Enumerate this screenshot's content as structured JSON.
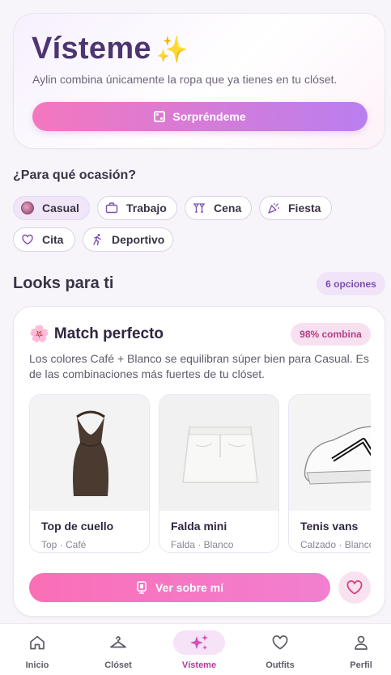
{
  "hero": {
    "title": "Vísteme",
    "sparkle": "✨",
    "subtitle": "Aylin combina únicamente la ropa que ya tienes en tu clóset.",
    "cta_label": "Sorpréndeme"
  },
  "occasion": {
    "question": "¿Para qué ocasión?",
    "chips": [
      {
        "label": "Casual",
        "icon": "casual-dot-icon",
        "selected": true
      },
      {
        "label": "Trabajo",
        "icon": "briefcase-icon",
        "selected": false
      },
      {
        "label": "Cena",
        "icon": "dinner-icon",
        "selected": false
      },
      {
        "label": "Fiesta",
        "icon": "party-popper-icon",
        "selected": false
      },
      {
        "label": "Cita",
        "icon": "heart-icon",
        "selected": false
      },
      {
        "label": "Deportivo",
        "icon": "running-icon",
        "selected": false
      }
    ]
  },
  "looks": {
    "title": "Looks para ti",
    "count_label": "6 opciones"
  },
  "card": {
    "emoji": "🌸",
    "title": "Match perfecto",
    "score_label": "98% combina",
    "description": "Los colores Café + Blanco se equilibran súper bien para Casual. Es de las combinaciones más fuertes de tu clóset.",
    "items": [
      {
        "name": "Top de cuello",
        "meta": "Top · Café"
      },
      {
        "name": "Falda mini",
        "meta": "Falda · Blanco"
      },
      {
        "name": "Tenis vans",
        "meta": "Calzado · Blanco"
      }
    ],
    "try_on_label": "Ver sobre mí"
  },
  "nav": [
    {
      "label": "Inicio",
      "icon": "home-icon",
      "active": false
    },
    {
      "label": "Clóset",
      "icon": "hanger-icon",
      "active": false
    },
    {
      "label": "Vísteme",
      "icon": "sparkles-icon",
      "active": true
    },
    {
      "label": "Outfits",
      "icon": "heart-icon",
      "active": false
    },
    {
      "label": "Perfil",
      "icon": "person-icon",
      "active": false
    }
  ],
  "colors": {
    "accent_pink": "#f477be",
    "accent_purple": "#b97ff0",
    "title_purple": "#4d3570",
    "nav_active": "#b5389b"
  }
}
